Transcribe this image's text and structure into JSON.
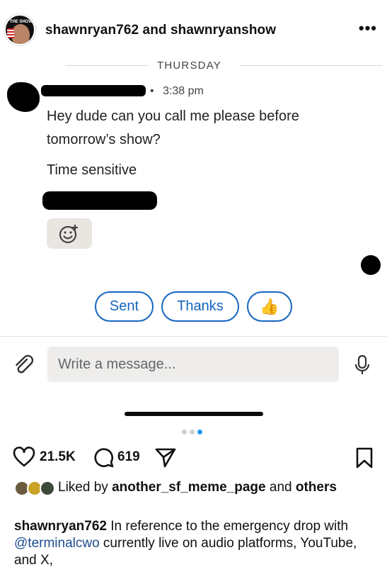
{
  "header": {
    "title": "shawnryan762 and shawnryanshow",
    "more_label": "•••",
    "avatar_badge": "THE SHOW"
  },
  "chat": {
    "day_label": "THURSDAY",
    "time_separator": "•",
    "time": "3:38 pm",
    "messages": [
      "Hey dude can you call me please before",
      "tomorrow’s show?",
      "Time sensitive"
    ]
  },
  "quick_replies": [
    {
      "label": "Sent"
    },
    {
      "label": "Thanks"
    },
    {
      "label": "👍"
    }
  ],
  "compose": {
    "placeholder": "Write a message..."
  },
  "carousel": {
    "total": 3,
    "active_index": 2
  },
  "post": {
    "likes": "21.5K",
    "comments": "619",
    "liked_by_prefix": "Liked by",
    "liked_by_user": "another_sf_meme_page",
    "liked_by_and": "and",
    "liked_by_others": "others",
    "caption_user": "shawnryan762",
    "caption_text_1": " In reference to the emergency drop with ",
    "caption_mention": "@terminalcwo",
    "caption_text_2": " currently live on audio platforms, YouTube, and X,"
  },
  "colors": {
    "accent": "#1565c0",
    "mention": "#1d4d8f",
    "active_dot": "#1d9bf0"
  }
}
